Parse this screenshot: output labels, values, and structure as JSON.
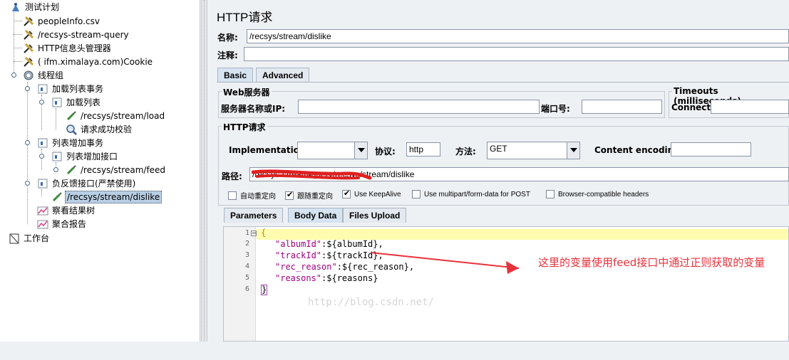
{
  "tree": {
    "items": [
      {
        "label": "测试计划",
        "icon": "test-plan-icon"
      },
      {
        "label": "peopleInfo.csv",
        "icon": "wrench-icon"
      },
      {
        "label": "/recsys-stream-query",
        "icon": "wrench-icon"
      },
      {
        "label": "HTTP信息头管理器",
        "icon": "wrench-icon"
      },
      {
        "label": "( ifm.ximalaya.com)Cookie",
        "icon": "wrench-icon"
      },
      {
        "label": "线程组",
        "icon": "gear-icon"
      },
      {
        "label": "加载列表事务",
        "icon": "transaction-icon"
      },
      {
        "label": "加载列表",
        "icon": "transaction-icon"
      },
      {
        "label": "/recsys/stream/load",
        "icon": "pipette-icon"
      },
      {
        "label": "请求成功校验",
        "icon": "magnifier-icon"
      },
      {
        "label": "列表增加事务",
        "icon": "transaction-icon"
      },
      {
        "label": "列表增加接口",
        "icon": "transaction-icon"
      },
      {
        "label": "/recsys/stream/feed",
        "icon": "pipette-icon"
      },
      {
        "label": "负反馈接口(严禁使用)",
        "icon": "transaction-icon"
      },
      {
        "label": "/recsys/stream/dislike",
        "icon": "pipette-icon"
      },
      {
        "label": "察看结果树",
        "icon": "chart-icon"
      },
      {
        "label": "聚合报告",
        "icon": "chart-icon"
      },
      {
        "label": "工作台",
        "icon": "workbench-icon"
      }
    ]
  },
  "main": {
    "title": "HTTP请求",
    "name_label": "名称:",
    "name_value": "/recsys/stream/dislike",
    "comment_label": "注释:",
    "comment_value": "",
    "tabs": [
      "Basic",
      "Advanced"
    ],
    "web_server": {
      "legend": "Web服务器",
      "server_label": "服务器名称或IP:",
      "server_value": "",
      "port_label": "端口号:",
      "port_value": ""
    },
    "timeouts": {
      "legend": "Timeouts (milliseconds)",
      "connect_label": "Connect:",
      "connect_value": ""
    },
    "http_request": {
      "legend": "HTTP请求",
      "impl_label": "Implementation:",
      "impl_value": "",
      "protocol_label": "协议:",
      "protocol_value": "http",
      "method_label": "方法:",
      "method_value": "GET",
      "encoding_label": "Content encoding:",
      "encoding_value": "",
      "path_label": "路径:",
      "path_value": "/recsys-stream-query/recsys/stream/dislike"
    },
    "checkboxes": [
      {
        "label": "自动重定向",
        "checked": false
      },
      {
        "label": "跟随重定向",
        "checked": true
      },
      {
        "label": "Use KeepAlive",
        "checked": true
      },
      {
        "label": "Use multipart/form-data for POST",
        "checked": false
      },
      {
        "label": "Browser-compatible headers",
        "checked": false
      }
    ],
    "sub_tabs": [
      "Parameters",
      "Body Data",
      "Files Upload"
    ],
    "body_lines": [
      {
        "n": "1",
        "text": "{"
      },
      {
        "n": "2",
        "key": "\"albumId\"",
        "rest": ":${albumId},"
      },
      {
        "n": "3",
        "key": "\"trackId\"",
        "rest": ":${trackId},"
      },
      {
        "n": "4",
        "key": "\"rec_reason\"",
        "rest": ":${rec_reason},"
      },
      {
        "n": "5",
        "key": "\"reasons\"",
        "rest": ":${reasons}"
      },
      {
        "n": "6",
        "text": "}"
      }
    ],
    "watermark": "http://blog.csdn.net/",
    "annotation": "这里的变量使用feed接口中通过正则获取的变量"
  },
  "colors": {
    "annotation": "#e8323b",
    "selected": "#b8cfe5",
    "editor_highlight": "#fffcaf"
  }
}
